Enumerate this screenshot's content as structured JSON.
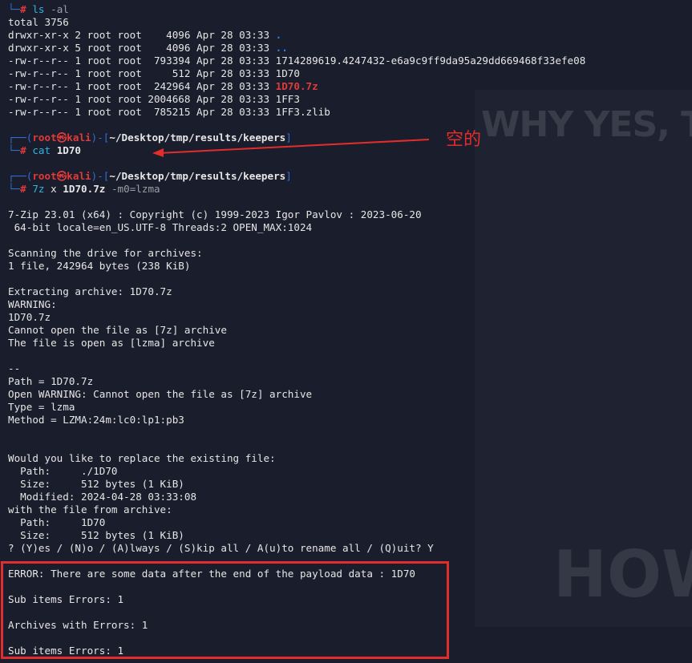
{
  "background": {
    "banner_top": "WHY YES, TH",
    "banner_bottom": "HOW"
  },
  "annotation": {
    "text": "空的",
    "color": "#e22d2d"
  },
  "terminal": {
    "prompt_user": "root",
    "prompt_symbol": "㉿",
    "prompt_host": "kali",
    "session1": {
      "command": "ls",
      "args": "-al",
      "output": [
        "total 3756",
        "drwxr-xr-x 2 root root    4096 Apr 28 03:33 ",
        "drwxr-xr-x 5 root root    4096 Apr 28 03:33 ",
        "-rw-r--r-- 1 root root  793394 Apr 28 03:33 1714289619.4247432-e6a9c9ff9da95a29dd669468f33efe08",
        "-rw-r--r-- 1 root root     512 Apr 28 03:33 1D70",
        "-rw-r--r-- 1 root root  242964 Apr 28 03:33 ",
        "-rw-r--r-- 1 root root 2004668 Apr 28 03:33 1FF3",
        "-rw-r--r-- 1 root root  785215 Apr 28 03:33 1FF3.zlib"
      ],
      "dir_dot": ".",
      "dir_dotdot": "..",
      "archive_file": "1D70.7z"
    },
    "session2": {
      "path": "~/Desktop/tmp/results/keepers",
      "command": "cat",
      "args": "1D70"
    },
    "session3": {
      "path": "~/Desktop/tmp/results/keepers",
      "command": "7z",
      "arg1": "x",
      "arg2": "1D70.7z",
      "arg3": "-m0=lzma",
      "output": [
        "7-Zip 23.01 (x64) : Copyright (c) 1999-2023 Igor Pavlov : 2023-06-20",
        " 64-bit locale=en_US.UTF-8 Threads:2 OPEN_MAX:1024",
        "",
        "Scanning the drive for archives:",
        "1 file, 242964 bytes (238 KiB)",
        "",
        "Extracting archive: 1D70.7z",
        "WARNING:",
        "1D70.7z",
        "Cannot open the file as [7z] archive",
        "The file is open as [lzma] archive",
        "",
        "--",
        "Path = 1D70.7z",
        "Open WARNING: Cannot open the file as [7z] archive",
        "Type = lzma",
        "Method = LZMA:24m:lc0:lp1:pb3",
        "",
        "",
        "Would you like to replace the existing file:",
        "  Path:     ./1D70",
        "  Size:     512 bytes (1 KiB)",
        "  Modified: 2024-04-28 03:33:08",
        "with the file from archive:",
        "  Path:     1D70",
        "  Size:     512 bytes (1 KiB)",
        "? (Y)es / (N)o / (A)lways / (S)kip all / A(u)to rename all / (Q)uit? Y",
        ""
      ],
      "errors": [
        "ERROR: There are some data after the end of the payload data : 1D70",
        "",
        "Sub items Errors: 1",
        "",
        "Archives with Errors: 1",
        "",
        "Sub items Errors: 1"
      ]
    }
  }
}
